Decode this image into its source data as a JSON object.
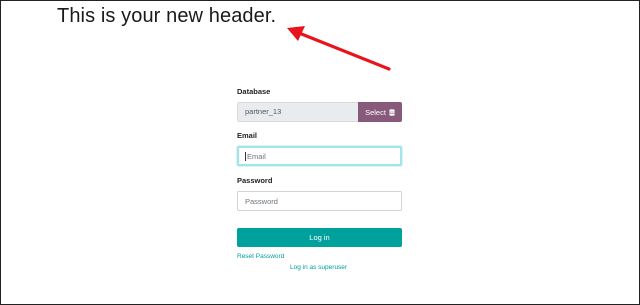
{
  "header": {
    "title": "This is your new header."
  },
  "annotation": {
    "arrow_color": "#e8141b"
  },
  "form": {
    "database": {
      "label": "Database",
      "value": "partner_13",
      "select_label": "Select",
      "select_icon": "database-icon"
    },
    "email": {
      "label": "Email",
      "placeholder": "Email"
    },
    "password": {
      "label": "Password",
      "placeholder": "Password"
    },
    "login_label": "Log in",
    "reset_password": "Reset Password",
    "superuser": "Log in as superuser"
  },
  "colors": {
    "primary": "#00a09d",
    "select_button": "#875a7b"
  }
}
